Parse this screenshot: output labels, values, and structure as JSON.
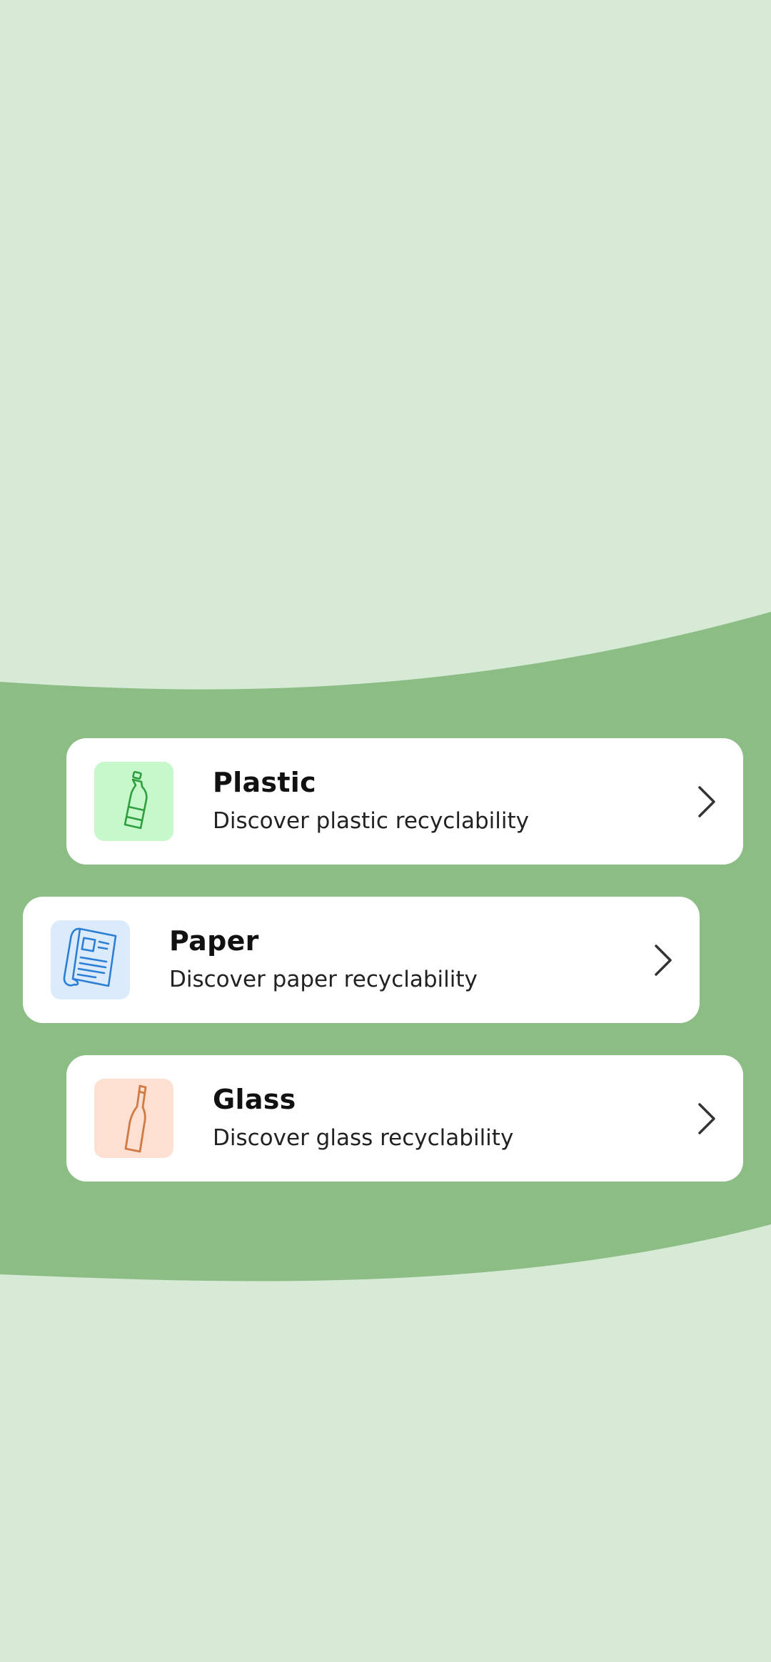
{
  "colors": {
    "background": "#d7ead6",
    "band": "#8bbd85",
    "card": "#ffffff",
    "plastic_tile": "#c7f8cc",
    "plastic_icon": "#2e9e3f",
    "paper_tile": "#dcebfb",
    "paper_icon": "#2d7fd6",
    "glass_tile": "#fde0d2",
    "glass_icon": "#d07a44"
  },
  "categories": [
    {
      "title": "Plastic",
      "subtitle": "Discover plastic recyclability",
      "icon": "plastic-bottle-icon"
    },
    {
      "title": "Paper",
      "subtitle": "Discover paper recyclability",
      "icon": "newspaper-icon"
    },
    {
      "title": "Glass",
      "subtitle": "Discover glass recyclability",
      "icon": "glass-bottle-icon"
    }
  ]
}
